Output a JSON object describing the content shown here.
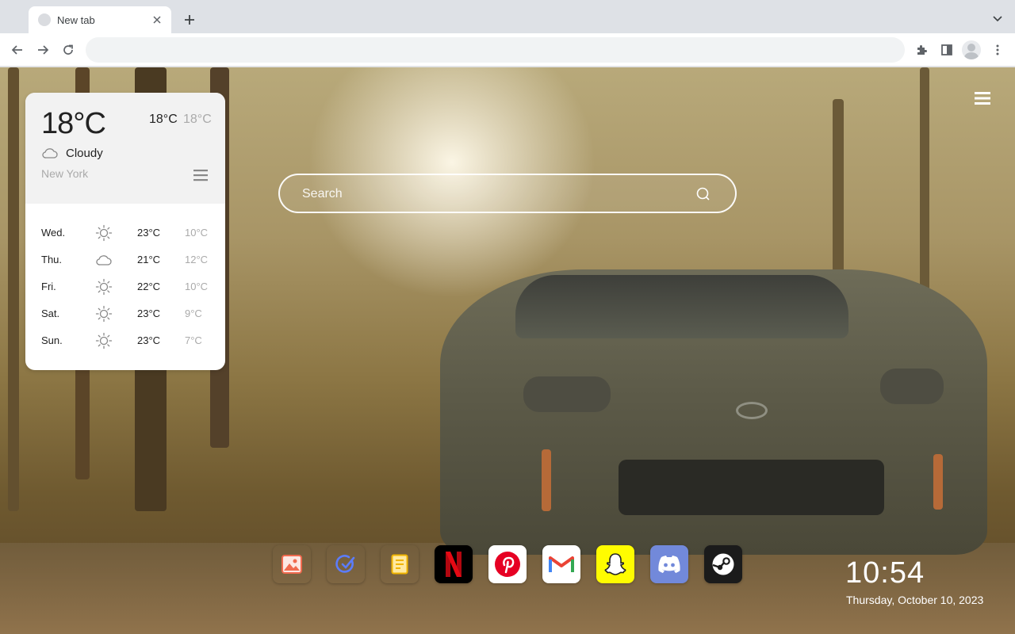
{
  "browser": {
    "tab": {
      "title": "New tab"
    },
    "omnibox": {
      "value": ""
    }
  },
  "weather": {
    "current_temp": "18°C",
    "high": "18°C",
    "low": "18°C",
    "condition": "Cloudy",
    "condition_icon": "cloud-icon",
    "city": "New York",
    "forecast": [
      {
        "day": "Wed.",
        "icon": "sun-icon",
        "high": "23°C",
        "low": "10°C"
      },
      {
        "day": "Thu.",
        "icon": "cloud-icon",
        "high": "21°C",
        "low": "12°C"
      },
      {
        "day": "Fri.",
        "icon": "sun-icon",
        "high": "22°C",
        "low": "10°C"
      },
      {
        "day": "Sat.",
        "icon": "sun-icon",
        "high": "23°C",
        "low": "9°C"
      },
      {
        "day": "Sun.",
        "icon": "sun-icon",
        "high": "23°C",
        "low": "7°C"
      }
    ]
  },
  "search": {
    "placeholder": "Search"
  },
  "dock": [
    {
      "name": "gallery",
      "icon": "image-icon",
      "bg": "#ffffff"
    },
    {
      "name": "tasks",
      "icon": "check-icon",
      "bg": "#ffffff"
    },
    {
      "name": "notes",
      "icon": "note-icon",
      "bg": "#ffffff"
    },
    {
      "name": "netflix",
      "icon": "netflix-icon",
      "bg": "#000000"
    },
    {
      "name": "pinterest",
      "icon": "pinterest-icon",
      "bg": "#ffffff"
    },
    {
      "name": "gmail",
      "icon": "gmail-icon",
      "bg": "#ffffff"
    },
    {
      "name": "snapchat",
      "icon": "snapchat-icon",
      "bg": "#fffc00"
    },
    {
      "name": "discord",
      "icon": "discord-icon",
      "bg": "#7289da"
    },
    {
      "name": "steam",
      "icon": "steam-icon",
      "bg": "#1b1b1b"
    }
  ],
  "clock": {
    "time": "10:54",
    "date": "Thursday, October 10, 2023"
  }
}
